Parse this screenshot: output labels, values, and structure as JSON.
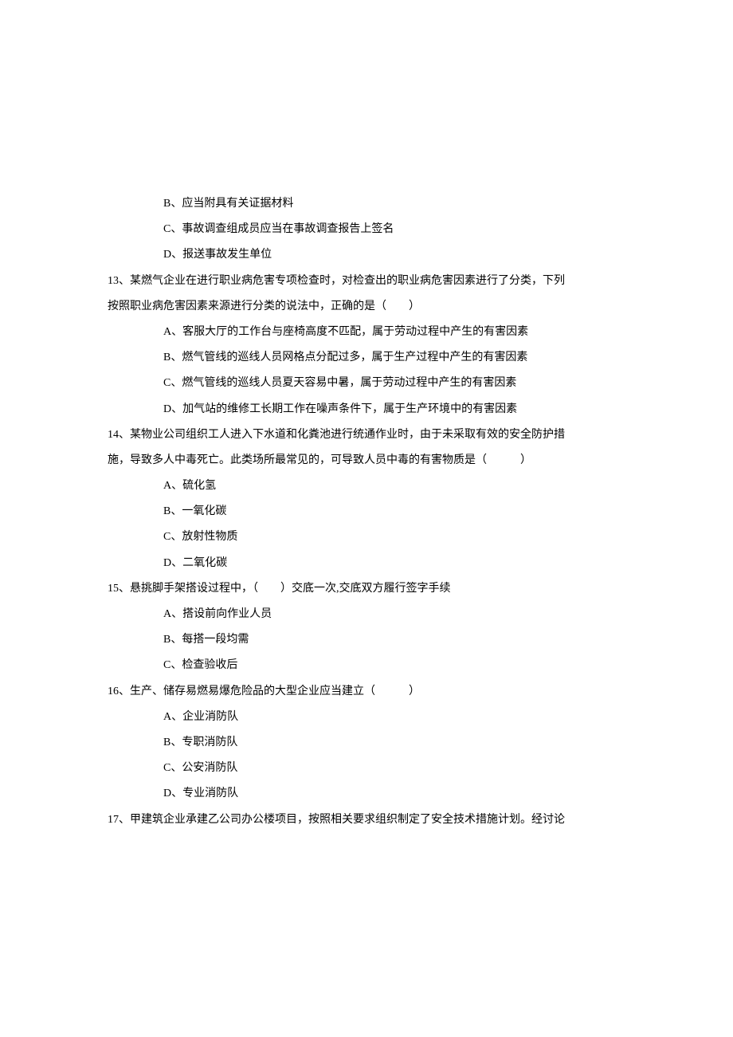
{
  "items": [
    {
      "type": "option",
      "text": "B、应当附具有关证据材料"
    },
    {
      "type": "option",
      "text": "C、事故调查组成员应当在事故调查报告上签名"
    },
    {
      "type": "option",
      "text": "D、报送事故发生单位"
    },
    {
      "type": "question",
      "text": "13、某燃气企业在进行职业病危害专项检查时，对检查出的职业病危害因素进行了分类，下列"
    },
    {
      "type": "question-cont",
      "text": "按照职业病危害因素来源进行分类的说法中，正确的是（　　）"
    },
    {
      "type": "option",
      "text": "A、客服大厅的工作台与座椅高度不匹配，属于劳动过程中产生的有害因素"
    },
    {
      "type": "option",
      "text": "B、燃气管线的巡线人员网格点分配过多，属于生产过程中产生的有害因素"
    },
    {
      "type": "option",
      "text": "C、燃气管线的巡线人员夏天容易中暑，属于劳动过程中产生的有害因素"
    },
    {
      "type": "option",
      "text": "D、加气站的维修工长期工作在噪声条件下，属于生产环境中的有害因素"
    },
    {
      "type": "question",
      "text": "14、某物业公司组织工人进入下水道和化粪池进行统通作业时，由于未采取有效的安全防护措"
    },
    {
      "type": "question-cont",
      "text": "施，导致多人中毒死亡。此类场所最常见的，可导致人员中毒的有害物质是（　　　）"
    },
    {
      "type": "option",
      "text": "A、硫化氢"
    },
    {
      "type": "option",
      "text": "B、一氧化碳"
    },
    {
      "type": "option",
      "text": "C、放射性物质"
    },
    {
      "type": "option",
      "text": "D、二氧化碳"
    },
    {
      "type": "question",
      "text": "15、悬挑脚手架搭设过程中，（　　）交底一次,交底双方履行签字手续"
    },
    {
      "type": "option",
      "text": "A、搭设前向作业人员"
    },
    {
      "type": "option",
      "text": "B、每搭一段均需"
    },
    {
      "type": "option",
      "text": "C、检查验收后"
    },
    {
      "type": "question",
      "text": "16、生产、储存易燃易爆危险品的大型企业应当建立（　　　）"
    },
    {
      "type": "option",
      "text": "A、企业消防队"
    },
    {
      "type": "option",
      "text": "B、专职消防队"
    },
    {
      "type": "option",
      "text": "C、公安消防队"
    },
    {
      "type": "option",
      "text": "D、专业消防队"
    },
    {
      "type": "question",
      "text": "17、甲建筑企业承建乙公司办公楼项目，按照相关要求组织制定了安全技术措施计划。经讨论"
    }
  ]
}
